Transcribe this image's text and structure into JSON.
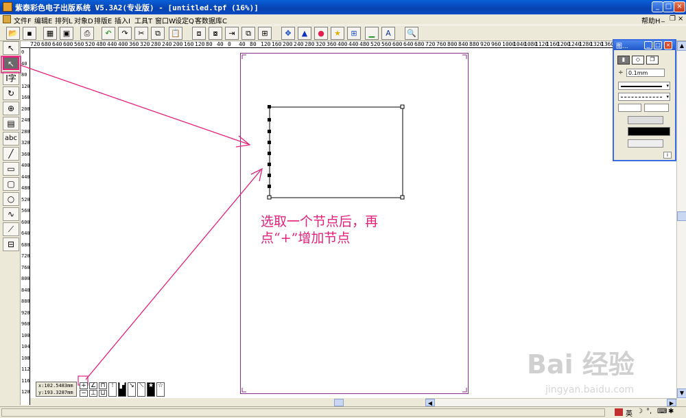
{
  "window": {
    "title": "紫泰彩色电子出版系统 V5.3A2(专业版) - [untitled.tpf (16%)]",
    "min": "_",
    "max": "□",
    "close": "×"
  },
  "menubar": {
    "items": [
      "文件F",
      "编辑E",
      "排列L",
      "对象D",
      "排版E",
      "插入I",
      "工具T",
      "窗口W",
      "设定Q",
      "客数据库C"
    ],
    "help": "帮助H",
    "doc_min": "_",
    "doc_restore": "❐",
    "doc_close": "×"
  },
  "rulers": {
    "h_labels": [
      "720",
      "680",
      "640",
      "600",
      "560",
      "520",
      "480",
      "440",
      "400",
      "360",
      "320",
      "280",
      "240",
      "200",
      "160",
      "120",
      "80",
      "40",
      "0",
      "40",
      "80",
      "120",
      "160",
      "200",
      "240",
      "280",
      "320",
      "360",
      "400",
      "440",
      "480",
      "520",
      "560",
      "600",
      "640",
      "680",
      "720",
      "760",
      "800",
      "840",
      "880",
      "920",
      "960",
      "1000",
      "1040",
      "1080",
      "1120",
      "1160",
      "1200",
      "1240",
      "1280",
      "1320",
      "1360"
    ],
    "v_labels": [
      "0",
      "40",
      "80",
      "120",
      "160",
      "200",
      "240",
      "280",
      "320",
      "360",
      "400",
      "440",
      "480",
      "520",
      "560",
      "600",
      "640",
      "680",
      "720",
      "760",
      "800",
      "840",
      "880",
      "920",
      "960",
      "1000",
      "1040",
      "1080",
      "1120",
      "1160",
      "1200"
    ]
  },
  "coords": {
    "x": "x:102.5483mm",
    "y": "y:193.3287mm"
  },
  "palette": {
    "title": "图...",
    "line_width": "0.1mm",
    "info": "i"
  },
  "annotation": {
    "line1": "选取一个节点后，再",
    "line2": "点“+”增加节点"
  },
  "watermark": {
    "brand": "Bai 经验",
    "url": "jingyan.baidu.com"
  },
  "status": {
    "ime": "英"
  },
  "colors": {
    "accent": "#e3207a",
    "page_border": "#8a2a8a",
    "title_bar": "#0a4bc4"
  }
}
